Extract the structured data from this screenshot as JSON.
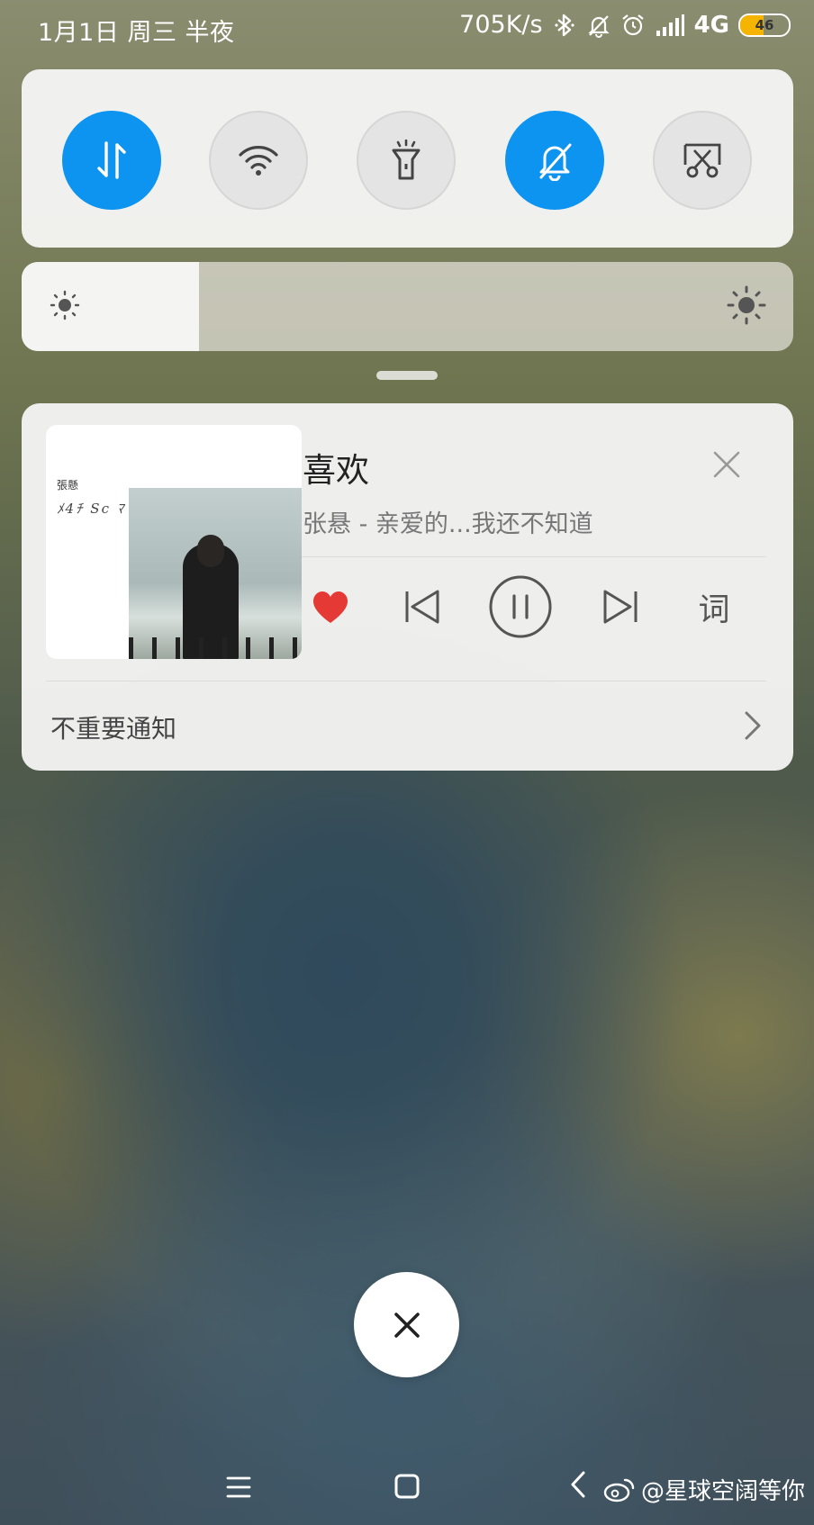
{
  "status_bar": {
    "datetime": "1月1日 周三 半夜",
    "net_speed": "705K/s",
    "network": "4G",
    "battery_level": "46",
    "icons": [
      "bluetooth-icon",
      "mute-icon",
      "alarm-icon",
      "signal-icon"
    ]
  },
  "quick_toggles": [
    {
      "name": "mobile-data",
      "icon": "data-arrows-icon",
      "state": "on"
    },
    {
      "name": "wifi",
      "icon": "wifi-icon",
      "state": "off"
    },
    {
      "name": "flashlight",
      "icon": "flashlight-icon",
      "state": "off"
    },
    {
      "name": "silent",
      "icon": "bell-off-icon",
      "state": "on"
    },
    {
      "name": "screenshot",
      "icon": "scissors-icon",
      "state": "off"
    }
  ],
  "brightness": {
    "level": 0.23
  },
  "media": {
    "title": "喜欢",
    "subtitle": "张悬 - 亲爱的...我还不知道",
    "lyrics_label": "词",
    "liked": true,
    "album_mark": "張懸",
    "album_script": "ﾒ4ﾁ Sc ﾏ ﾓ ｼ 5"
  },
  "unimportant_notifications": {
    "label": "不重要通知"
  },
  "watermark": {
    "text": "@星球空阔等你"
  },
  "colors": {
    "accent": "#0d93f0",
    "heart": "#e53935",
    "battery": "#f5b400"
  }
}
